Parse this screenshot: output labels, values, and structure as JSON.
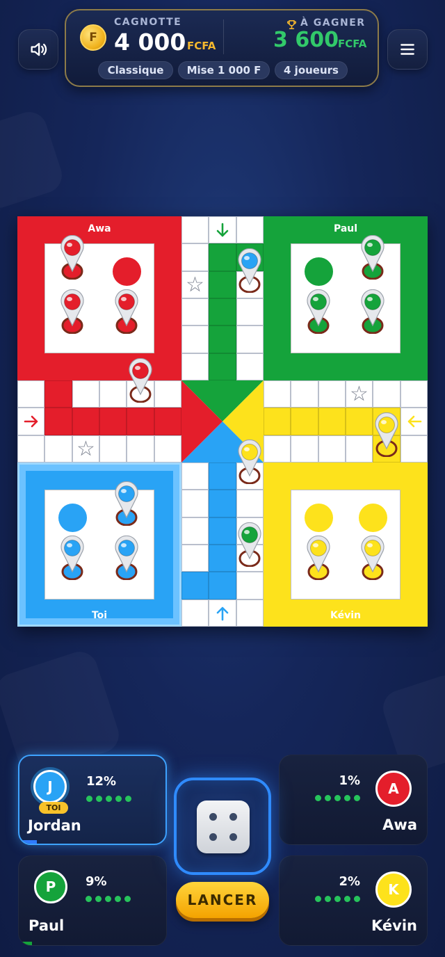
{
  "header": {
    "sound_icon": "speaker-icon",
    "menu_icon": "hamburger-menu-icon",
    "jackpot": {
      "coin_letter": "F",
      "label": "CAGNOTTE",
      "amount": "4 000",
      "currency": "FCFA",
      "win_label": "À GAGNER",
      "win_icon": "trophy-icon",
      "win_amount": "3 600",
      "win_currency": "FCFA"
    },
    "pills": [
      "Classique",
      "Mise 1 000 F",
      "4 joueurs"
    ]
  },
  "board": {
    "bases": {
      "red": "Awa",
      "green": "Paul",
      "blue": "Toi",
      "yellow": "Kévin"
    },
    "colors": {
      "red": "#e41e2b",
      "green": "#15a33b",
      "blue": "#29a3f5",
      "yellow": "#fde21c"
    }
  },
  "players": {
    "me": {
      "name": "Jordan",
      "initial": "J",
      "badge": "TOI",
      "percent": "12%",
      "color": "#29a3f5",
      "progress": 0.12
    },
    "paul": {
      "name": "Paul",
      "initial": "P",
      "percent": "9%",
      "color": "#15a33b",
      "progress": 0.09
    },
    "awa": {
      "name": "Awa",
      "initial": "A",
      "percent": "1%",
      "color": "#e41e2b",
      "progress": 0.01
    },
    "kevin": {
      "name": "Kévin",
      "initial": "K",
      "percent": "2%",
      "color": "#fde21c",
      "progress": 0.02
    }
  },
  "dice": {
    "value": 4
  },
  "roll_button": "LANCER"
}
